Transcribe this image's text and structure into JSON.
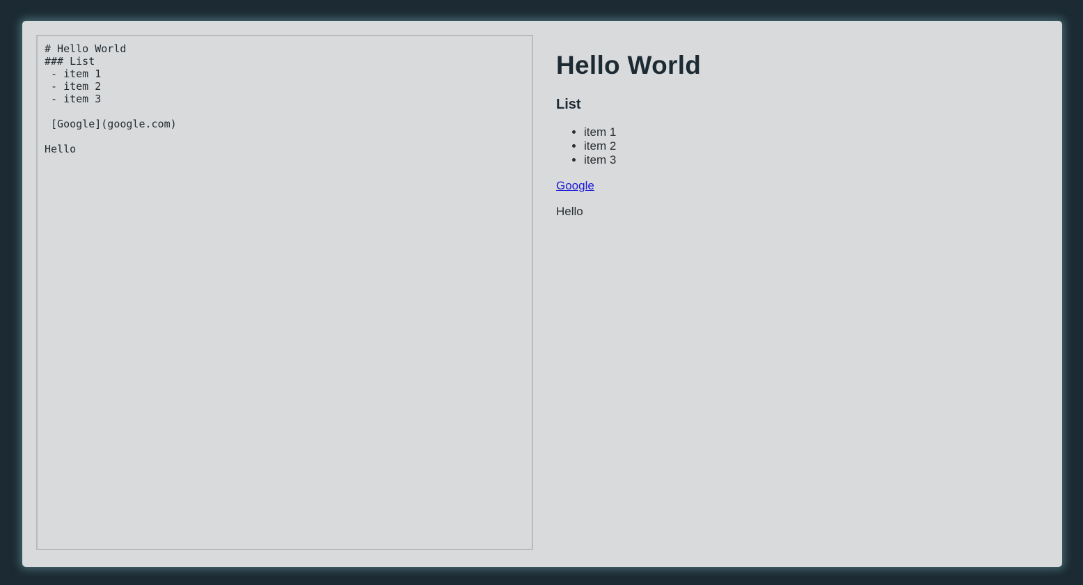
{
  "editor": {
    "content": "# Hello World\n### List\n - item 1\n - item 2\n - item 3\n\n [Google](google.com)\n\nHello"
  },
  "preview": {
    "heading": "Hello World",
    "subheading": "List",
    "list_items": [
      "item 1",
      "item 2",
      "item 3"
    ],
    "link_text": "Google",
    "paragraph": "Hello"
  },
  "colors": {
    "background": "#1c2b33",
    "card": "#d9dadc",
    "link": "#1a1ad6"
  }
}
